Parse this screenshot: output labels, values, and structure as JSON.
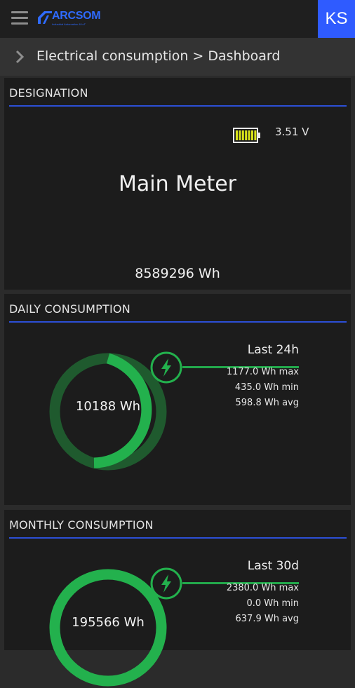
{
  "header": {
    "logo_text": "ARCSOM",
    "logo_subtitle": "Industrial Automation & IoT",
    "user_initials": "KS"
  },
  "breadcrumb": {
    "text": "Electrical consumption > Dashboard"
  },
  "designation": {
    "title": "DESIGNATION",
    "voltage": "3.51 V",
    "battery_level": 1.0,
    "meter_name": "Main Meter",
    "total": "8589296 Wh"
  },
  "daily": {
    "title": "DAILY CONSUMPTION",
    "value": "10188 Wh",
    "period": "Last 24h",
    "max": "1177.0 Wh max",
    "min": "435.0 Wh min",
    "avg": "598.8 Wh avg"
  },
  "monthly": {
    "title": "MONTHLY CONSUMPTION",
    "value": "195566 Wh",
    "period": "Last 30d",
    "max": "2380.0 Wh max",
    "min": "0.0 Wh min",
    "avg": "637.9 Wh avg"
  },
  "colors": {
    "accent_blue": "#2f5bff",
    "rule_blue": "#2c4fd6",
    "green": "#23b14d",
    "dark_green": "#1f5a2e",
    "battery": "#d8e21a"
  }
}
